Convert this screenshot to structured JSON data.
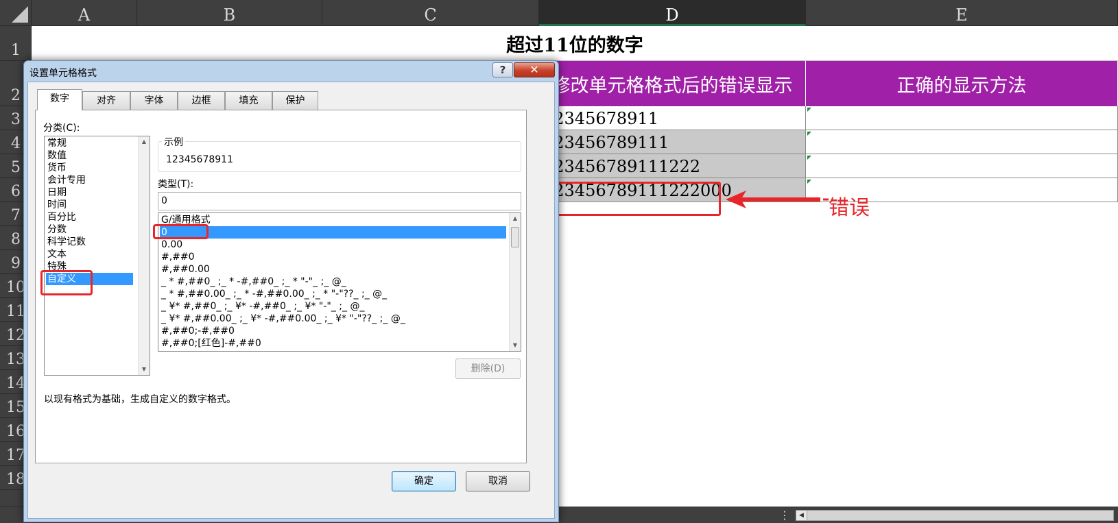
{
  "sheet": {
    "columns": [
      "A",
      "B",
      "C",
      "D",
      "E"
    ],
    "active_column": "D",
    "rows": [
      "1",
      "2",
      "3",
      "4",
      "5",
      "6",
      "7",
      "8",
      "9",
      "10",
      "11",
      "12",
      "13",
      "14",
      "15",
      "16",
      "17",
      "18"
    ],
    "title": "超过11位的数字",
    "header_d": "修改单元格格式后的错误显示",
    "header_e": "正确的显示方法",
    "values": [
      "12345678911",
      "123456789111",
      "123456789111222",
      "123456789111222000"
    ],
    "annotation": "错误",
    "colors": {
      "header_bg": "#a020a8",
      "annotation": "#e8262a",
      "grey_cell": "#c9c9c9"
    }
  },
  "dialog": {
    "title": "设置单元格格式",
    "help_icon": "?",
    "close_icon": "✕",
    "tabs": [
      "数字",
      "对齐",
      "字体",
      "边框",
      "填充",
      "保护"
    ],
    "active_tab": "数字",
    "category_label": "分类(C):",
    "categories": [
      "常规",
      "数值",
      "货币",
      "会计专用",
      "日期",
      "时间",
      "百分比",
      "分数",
      "科学记数",
      "文本",
      "特殊",
      "自定义"
    ],
    "selected_category": "自定义",
    "sample_label": "示例",
    "sample_value": "12345678911",
    "type_label": "类型(T):",
    "type_value": "0",
    "types": [
      "G/通用格式",
      "0",
      "0.00",
      "#,##0",
      "#,##0.00",
      "_ * #,##0_ ;_ * -#,##0_ ;_ * \"-\"_ ;_ @_",
      "_ * #,##0.00_ ;_ * -#,##0.00_ ;_ * \"-\"??_ ;_ @_",
      "_ ¥* #,##0_ ;_ ¥* -#,##0_ ;_ ¥* \"-\"_ ;_ @_",
      "_ ¥* #,##0.00_ ;_ ¥* -#,##0.00_ ;_ ¥* \"-\"??_ ;_ @_",
      "#,##0;-#,##0",
      "#,##0;[红色]-#,##0"
    ],
    "selected_type": "0",
    "delete_button": "删除(D)",
    "description": "以现有格式为基础，生成自定义的数字格式。",
    "ok_button": "确定",
    "cancel_button": "取消"
  }
}
